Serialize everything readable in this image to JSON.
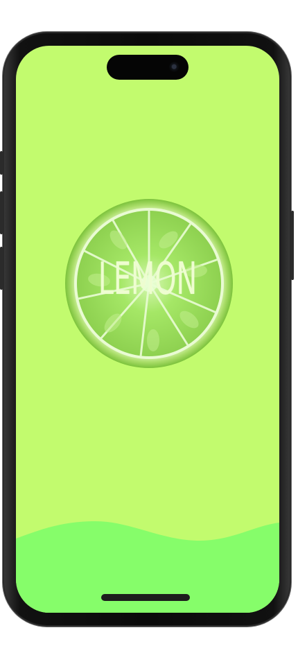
{
  "app": {
    "brand_text": "LEMON"
  },
  "colors": {
    "background": "#c2fb6e",
    "wave": "#86fd6a",
    "brand_text": "#eefdd0",
    "lime_outer": "#8fd14b",
    "lime_flesh": "#9fe65a"
  },
  "icons": {
    "hero_image": "lime-slice-image",
    "camera": "front-camera-icon"
  }
}
